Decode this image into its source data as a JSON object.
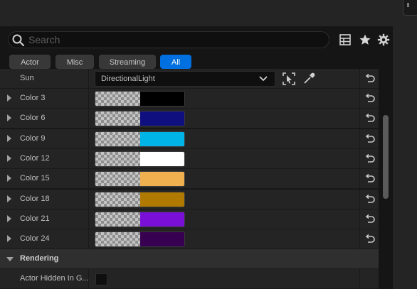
{
  "search": {
    "placeholder": "Search"
  },
  "filters": [
    {
      "label": "Actor",
      "active": false
    },
    {
      "label": "Misc",
      "active": false
    },
    {
      "label": "Streaming",
      "active": false
    },
    {
      "label": "All",
      "active": true
    }
  ],
  "sun": {
    "label": "Sun",
    "value": "DirectionalLight"
  },
  "colors": [
    {
      "label": "Color 3",
      "hex": "#000000"
    },
    {
      "label": "Color 6",
      "hex": "#0f0f7f"
    },
    {
      "label": "Color 9",
      "hex": "#00b4e8"
    },
    {
      "label": "Color 12",
      "hex": "#ffffff"
    },
    {
      "label": "Color 15",
      "hex": "#f0b050"
    },
    {
      "label": "Color 18",
      "hex": "#b07a00"
    },
    {
      "label": "Color 21",
      "hex": "#7a10d8"
    },
    {
      "label": "Color 24",
      "hex": "#380050"
    }
  ],
  "rendering": {
    "section_label": "Rendering",
    "actor_hidden_label": "Actor Hidden In G..."
  },
  "theme": {
    "accent": "#0070e0",
    "panel": "#242424",
    "background": "#151515"
  }
}
